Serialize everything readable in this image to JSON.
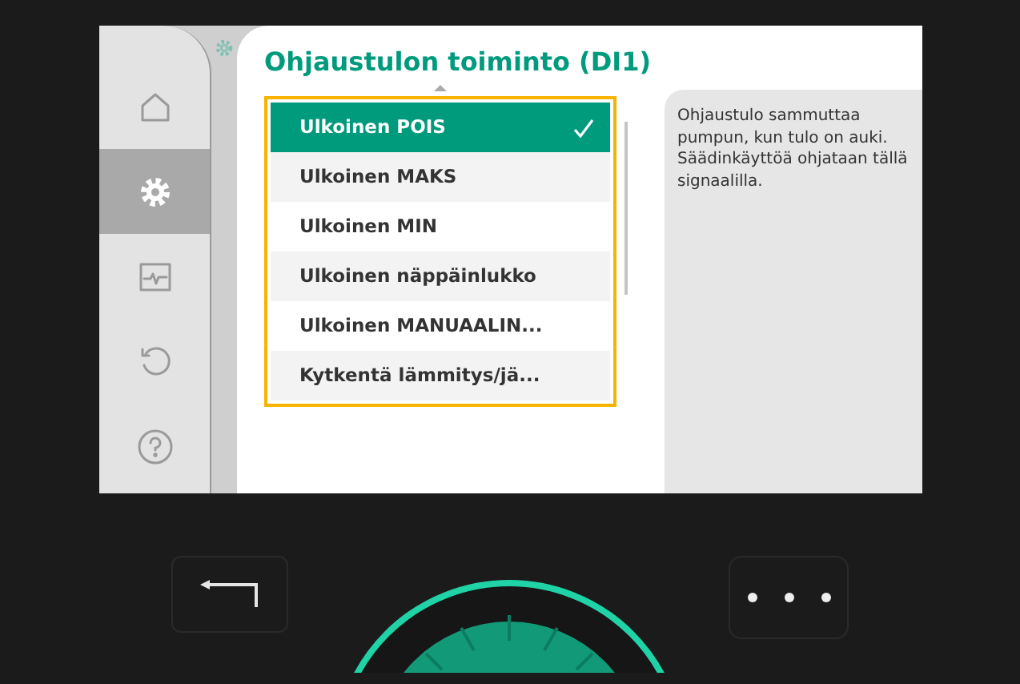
{
  "sidebar": {
    "items": [
      {
        "kind": "home",
        "selected": false
      },
      {
        "kind": "settings",
        "selected": true
      },
      {
        "kind": "pulse",
        "selected": false
      },
      {
        "kind": "undo",
        "selected": false
      },
      {
        "kind": "help",
        "selected": false
      }
    ]
  },
  "title": "Ohjaustulon toiminto (DI1)",
  "options": [
    {
      "label": "Ulkoinen POIS",
      "selected": true
    },
    {
      "label": "Ulkoinen MAKS",
      "selected": false
    },
    {
      "label": "Ulkoinen MIN",
      "selected": false
    },
    {
      "label": "Ulkoinen näppäinlukko",
      "selected": false
    },
    {
      "label": "Ulkoinen MANUAALIN...",
      "selected": false
    },
    {
      "label": "Kytkentä lämmitys/jä...",
      "selected": false
    }
  ],
  "help_text": "Ohjaustulo sammuttaa pumpun, kun tulo on auki. Säädinkäyttöä ohjataan tällä signaalilla."
}
